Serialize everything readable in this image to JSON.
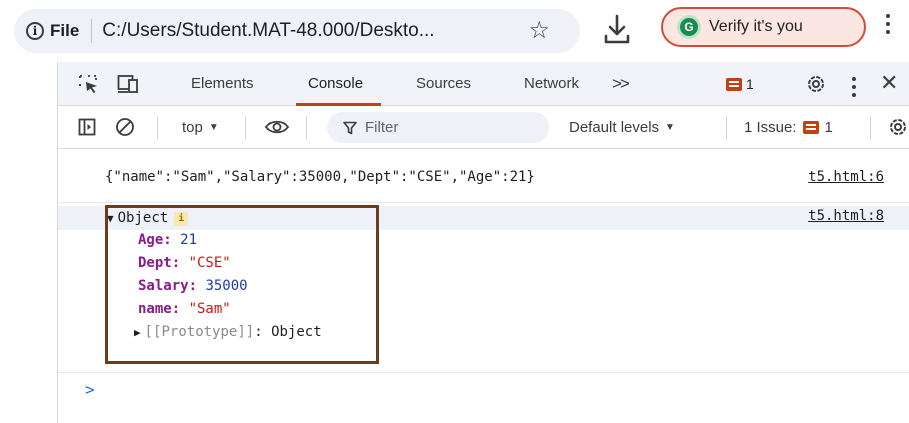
{
  "browser": {
    "file_label": "File",
    "url": "C:/Users/Student.MAT-48.000/Deskto...",
    "verify_label": "Verify it's you",
    "avatar_letter": "G"
  },
  "devtools": {
    "tabs": [
      "Elements",
      "Console",
      "Sources",
      "Network"
    ],
    "more_tabs": ">>",
    "active_tab": "Console",
    "message_count": "1"
  },
  "toolbar": {
    "context": "top",
    "filter_placeholder": "Filter",
    "levels": "Default levels",
    "issues_label": "1 Issue:",
    "issues_count": "1"
  },
  "console": {
    "line1_text": "{\"name\":\"Sam\",\"Salary\":35000,\"Dept\":\"CSE\",\"Age\":21}",
    "line1_source": "t5.html:6",
    "line2_source": "t5.html:8",
    "object_label": "Object",
    "info_badge": "i",
    "properties": [
      {
        "key": "Age",
        "value": "21"
      },
      {
        "key": "Dept",
        "value": "\"CSE\""
      },
      {
        "key": "Salary",
        "value": "35000"
      },
      {
        "key": "name",
        "value": "\"Sam\""
      }
    ],
    "prototype_key": "[[Prototype]]",
    "prototype_value": "Object",
    "prompt": ">"
  },
  "colors": {
    "accent": "#c2410c",
    "highlight_box": "#6a3d1f",
    "number": "#1c3aa9",
    "string": "#c41a16",
    "key": "#8b1a8b"
  }
}
